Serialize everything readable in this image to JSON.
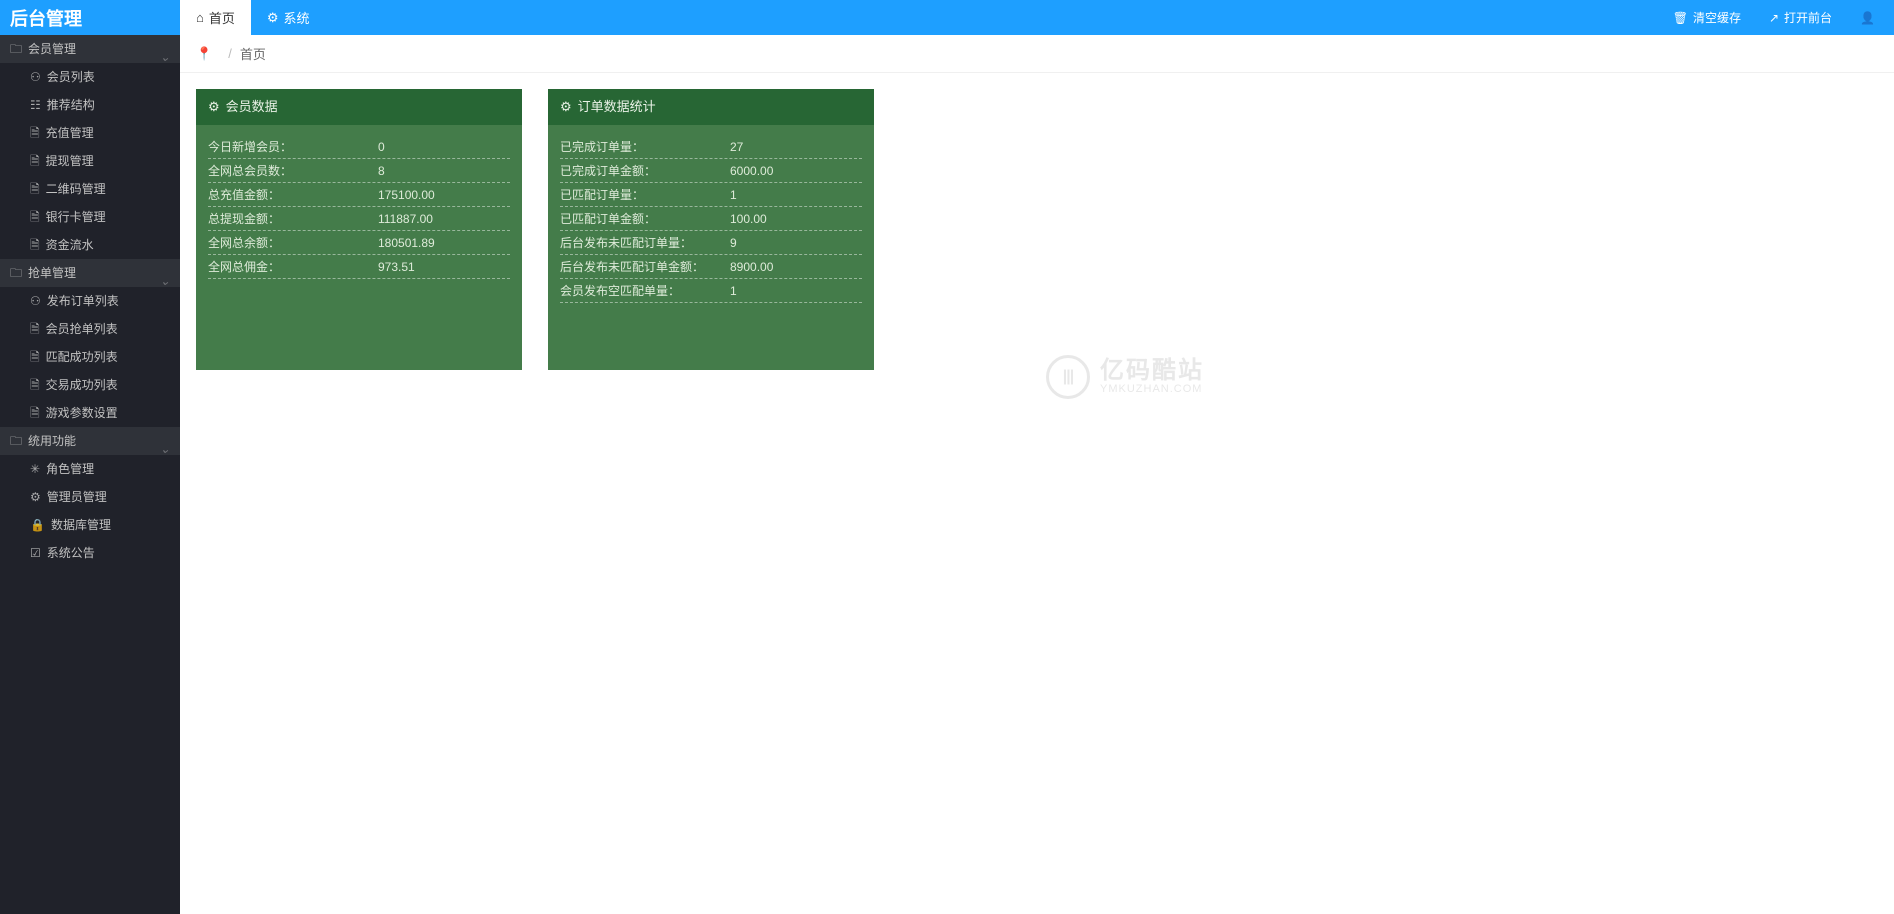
{
  "brand": "后台管理",
  "tabs": [
    {
      "label": "首页",
      "icon": "⌂",
      "active": true
    },
    {
      "label": "系统",
      "icon": "⚙",
      "active": false
    }
  ],
  "header_actions": {
    "clear_cache": "清空缓存",
    "open_front": "打开前台"
  },
  "breadcrumb": {
    "current": "首页"
  },
  "sidebar": [
    {
      "title": "会员管理",
      "icon": "🗀",
      "items": [
        {
          "label": "会员列表",
          "icon": "⚇"
        },
        {
          "label": "推荐结构",
          "icon": "☷"
        },
        {
          "label": "充值管理",
          "icon": "🗎"
        },
        {
          "label": "提现管理",
          "icon": "🗎"
        },
        {
          "label": "二维码管理",
          "icon": "🗎"
        },
        {
          "label": "银行卡管理",
          "icon": "🗎"
        },
        {
          "label": "资金流水",
          "icon": "🗎"
        }
      ]
    },
    {
      "title": "抢单管理",
      "icon": "🗀",
      "items": [
        {
          "label": "发布订单列表",
          "icon": "⚇"
        },
        {
          "label": "会员抢单列表",
          "icon": "🗎"
        },
        {
          "label": "匹配成功列表",
          "icon": "🗎"
        },
        {
          "label": "交易成功列表",
          "icon": "🗎"
        },
        {
          "label": "游戏参数设置",
          "icon": "🗎"
        }
      ]
    },
    {
      "title": "统用功能",
      "icon": "🗀",
      "items": [
        {
          "label": "角色管理",
          "icon": "✳"
        },
        {
          "label": "管理员管理",
          "icon": "⚙"
        },
        {
          "label": "数据库管理",
          "icon": "🔒"
        },
        {
          "label": "系统公告",
          "icon": "☑"
        }
      ]
    }
  ],
  "cards": [
    {
      "title": "会员数据",
      "rows": [
        {
          "label": "今日新增会员：",
          "value": "0"
        },
        {
          "label": "全网总会员数：",
          "value": "8"
        },
        {
          "label": "总充值金额：",
          "value": "175100.00"
        },
        {
          "label": "总提现金额：",
          "value": "111887.00"
        },
        {
          "label": "全网总余额：",
          "value": "180501.89"
        },
        {
          "label": "全网总佣金：",
          "value": "973.51"
        }
      ]
    },
    {
      "title": "订单数据统计",
      "rows": [
        {
          "label": "已完成订单量：",
          "value": "27"
        },
        {
          "label": "已完成订单金额：",
          "value": "6000.00"
        },
        {
          "label": "已匹配订单量：",
          "value": "1"
        },
        {
          "label": "已匹配订单金额：",
          "value": "100.00"
        },
        {
          "label": "后台发布未匹配订单量：",
          "value": "9"
        },
        {
          "label": "后台发布未匹配订单金额：",
          "value": "8900.00"
        },
        {
          "label": "会员发布空匹配单量：",
          "value": "1"
        }
      ]
    }
  ],
  "watermark": {
    "cn": "亿码酷站",
    "en": "YMKUZHAN.COM"
  }
}
